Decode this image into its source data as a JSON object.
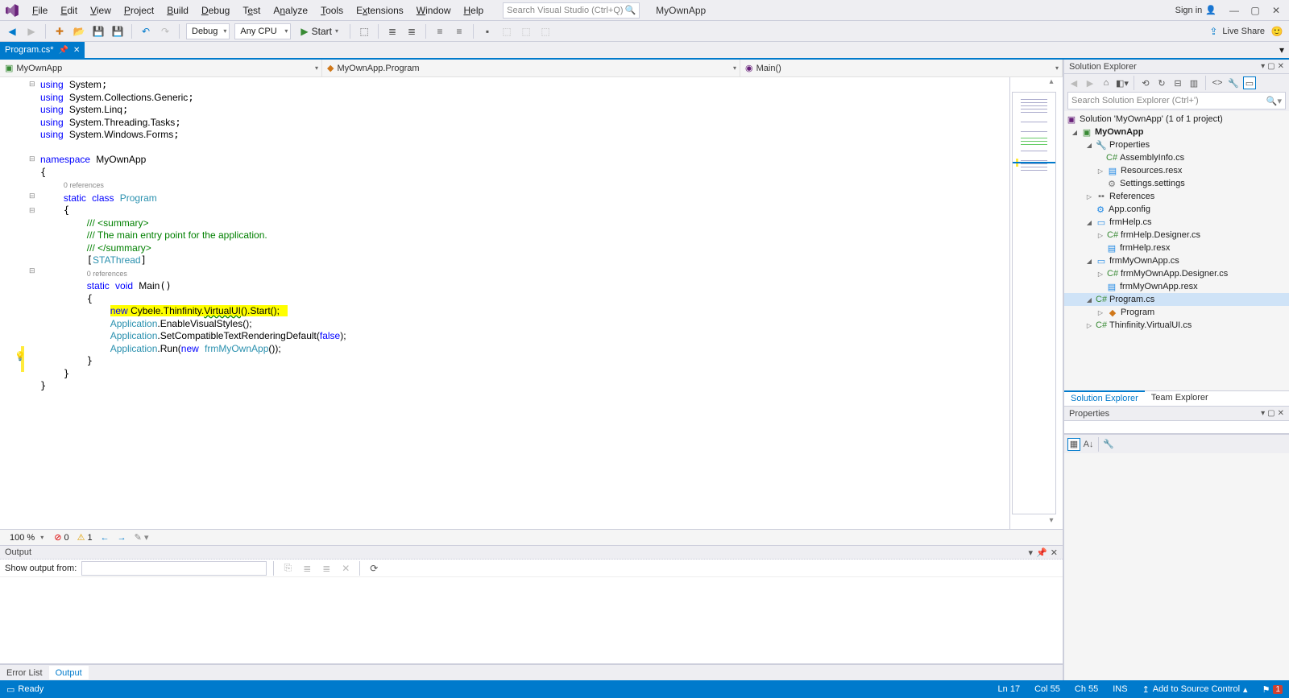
{
  "menubar": {
    "items": [
      "File",
      "Edit",
      "View",
      "Project",
      "Build",
      "Debug",
      "Test",
      "Analyze",
      "Tools",
      "Extensions",
      "Window",
      "Help"
    ],
    "search_placeholder": "Search Visual Studio (Ctrl+Q)",
    "app_name": "MyOwnApp",
    "sign_in": "Sign in"
  },
  "toolbar": {
    "config": "Debug",
    "platform": "Any CPU",
    "start": "Start",
    "live_share": "Live Share"
  },
  "doc_tab": {
    "title": "Program.cs*"
  },
  "nav": {
    "project": "MyOwnApp",
    "class": "MyOwnApp.Program",
    "member": "Main()"
  },
  "code": {
    "l1_using": "using",
    "l1_sys": "System",
    "l2": "System.Collections.Generic",
    "l3": "System.Linq",
    "l4": "System.Threading.Tasks",
    "l5": "System.Windows.Forms",
    "ns": "namespace",
    "nsname": "MyOwnApp",
    "ref0": "0 references",
    "static": "static",
    "cls": "class",
    "prog": "Program",
    "c1": "/// <summary>",
    "c2": "/// The main entry point for the application.",
    "c3": "/// </summary>",
    "attr": "STAThread",
    "void": "void",
    "main": "Main",
    "new": "new",
    "cybele": "Cybele.Thinfinity.",
    "vui": "VirtualUI",
    "startcall": "().Start();",
    "app": "Application",
    "evs": ".EnableVisualStyles();",
    "scrd": ".SetCompatibleTextRenderingDefault(",
    "false": "false",
    "close": ");",
    "run": ".Run(",
    "frm": "frmMyOwnApp",
    "runend": "());"
  },
  "editor_footer": {
    "zoom": "100 %",
    "errors": "0",
    "warnings": "1"
  },
  "output": {
    "title": "Output",
    "label": "Show output from:"
  },
  "bottom_tabs": {
    "errlist": "Error List",
    "output": "Output"
  },
  "solution_explorer": {
    "title": "Solution Explorer",
    "search_placeholder": "Search Solution Explorer (Ctrl+')",
    "root": "Solution 'MyOwnApp' (1 of 1 project)",
    "app": "MyOwnApp",
    "properties": "Properties",
    "assemblyinfo": "AssemblyInfo.cs",
    "resources": "Resources.resx",
    "settings": "Settings.settings",
    "references": "References",
    "appconfig": "App.config",
    "frmhelp": "frmHelp.cs",
    "frmhelpdes": "frmHelp.Designer.cs",
    "frmhelpresx": "frmHelp.resx",
    "frmown": "frmMyOwnApp.cs",
    "frmowndes": "frmMyOwnApp.Designer.cs",
    "frmownresx": "frmMyOwnApp.resx",
    "programcs": "Program.cs",
    "program": "Program",
    "thinfinity": "Thinfinity.VirtualUI.cs",
    "tab_se": "Solution Explorer",
    "tab_te": "Team Explorer"
  },
  "properties": {
    "title": "Properties"
  },
  "status": {
    "ready": "Ready",
    "ln": "Ln 17",
    "col": "Col 55",
    "ch": "Ch 55",
    "ins": "INS",
    "source": "Add to Source Control",
    "notif": "1"
  }
}
